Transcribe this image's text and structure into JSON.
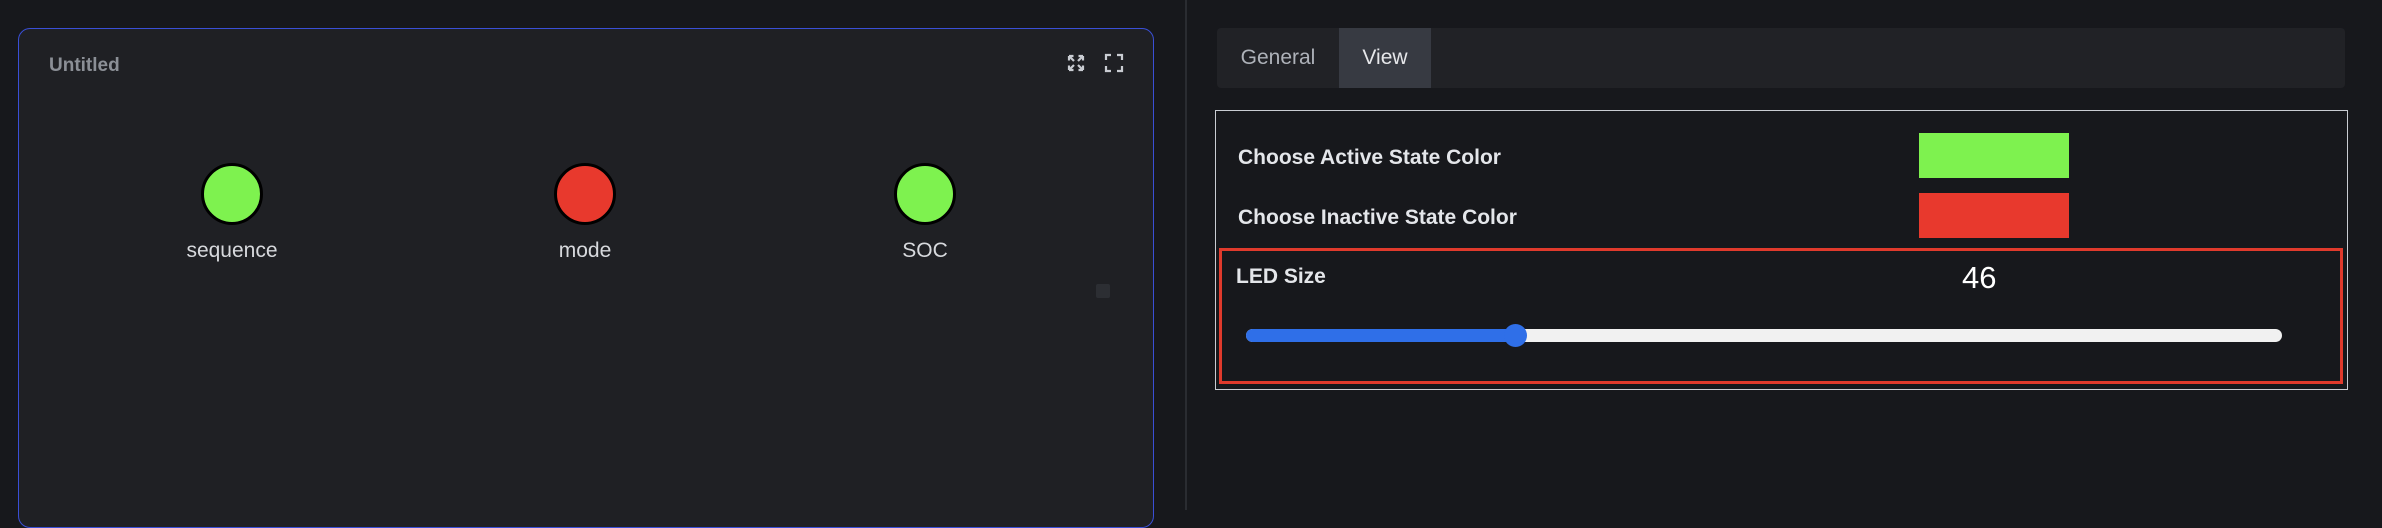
{
  "widget": {
    "title": "Untitled",
    "icons": [
      "expand-arrows-icon",
      "fullscreen-icon"
    ],
    "leds": [
      {
        "label": "sequence",
        "state": "active",
        "color": "#7ef24f"
      },
      {
        "label": "mode",
        "state": "inactive",
        "color": "#e8392d"
      },
      {
        "label": "SOC",
        "state": "active",
        "color": "#7ef24f"
      }
    ]
  },
  "settings": {
    "tabs": [
      {
        "label": "General",
        "active": false
      },
      {
        "label": "View",
        "active": true
      }
    ],
    "active_color_label": "Choose Active State Color",
    "active_color": "#7ef24f",
    "inactive_color_label": "Choose Inactive State Color",
    "inactive_color": "#e8392d",
    "led_size_label": "LED Size",
    "led_size_value": "46",
    "led_size_fraction": 0.26,
    "accent_color": "#2f6fe8",
    "highlight_color": "#e03a2c"
  }
}
